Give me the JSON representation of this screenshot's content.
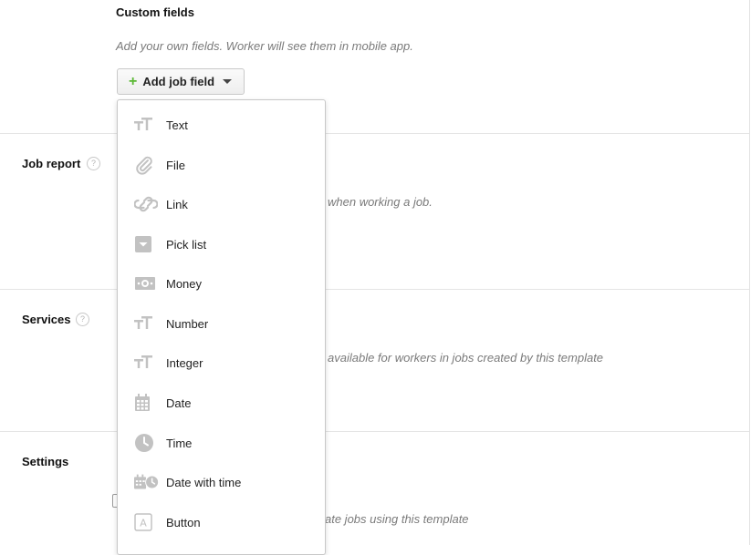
{
  "custom_fields": {
    "title": "Custom fields",
    "description": "Add your own fields. Worker will see them in mobile app.",
    "add_button_label": "Add job field",
    "add_button_icon": "plus-icon",
    "dropdown_icon": "caret-down-icon"
  },
  "sections": {
    "job_report": {
      "title": "Job report",
      "help": "?",
      "description_partial": "when working a job."
    },
    "services": {
      "title": "Services",
      "help": "?",
      "description_partial": "available for workers in jobs created by this template"
    },
    "settings": {
      "title": "Settings",
      "description_partial": "ate jobs using this template"
    }
  },
  "field_type_menu": {
    "items": [
      {
        "label": "Text",
        "icon": "text-icon"
      },
      {
        "label": "File",
        "icon": "paperclip-icon"
      },
      {
        "label": "Link",
        "icon": "link-icon"
      },
      {
        "label": "Pick list",
        "icon": "pick-list-icon"
      },
      {
        "label": "Money",
        "icon": "money-icon"
      },
      {
        "label": "Number",
        "icon": "number-icon"
      },
      {
        "label": "Integer",
        "icon": "integer-icon"
      },
      {
        "label": "Date",
        "icon": "calendar-icon"
      },
      {
        "label": "Time",
        "icon": "clock-icon"
      },
      {
        "label": "Date with time",
        "icon": "calendar-clock-icon"
      },
      {
        "label": "Button",
        "icon": "button-icon"
      }
    ]
  },
  "colors": {
    "accent_plus": "#5bb834",
    "icon_gray": "#c2c2c2",
    "description_gray": "#7a7a7a"
  }
}
